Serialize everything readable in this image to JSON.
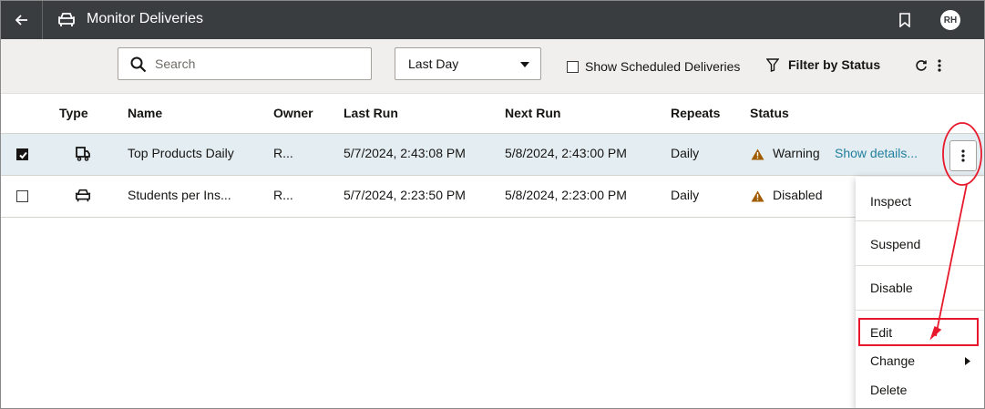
{
  "app": {
    "title": "Monitor Deliveries",
    "avatar_initials": "RH"
  },
  "toolbar": {
    "search_placeholder": "Search",
    "range_select": "Last Day",
    "show_scheduled_label": "Show Scheduled Deliveries",
    "show_scheduled_checked": false,
    "filter_label": "Filter by Status"
  },
  "table": {
    "headers": {
      "type": "Type",
      "name": "Name",
      "owner": "Owner",
      "last_run": "Last Run",
      "next_run": "Next Run",
      "repeats": "Repeats",
      "status": "Status"
    },
    "rows": [
      {
        "selected": true,
        "type_icon": "truck-icon",
        "name": "Top Products Daily",
        "owner": "R...",
        "last_run": "5/7/2024, 2:43:08 PM",
        "next_run": "5/8/2024, 2:43:00 PM",
        "repeats": "Daily",
        "status": "Warning",
        "status_link": "Show details..."
      },
      {
        "selected": false,
        "type_icon": "car-icon",
        "name": "Students per Ins...",
        "owner": "R...",
        "last_run": "5/7/2024, 2:23:50 PM",
        "next_run": "5/8/2024, 2:23:00 PM",
        "repeats": "Daily",
        "status": "Disabled",
        "status_link_fragment": "·"
      }
    ]
  },
  "context_menu": {
    "items": [
      "Inspect",
      "Suspend",
      "Disable",
      "Edit",
      "Change",
      "Delete"
    ],
    "highlighted": "Edit"
  },
  "colors": {
    "titlebar": "#3a3d40",
    "toolbar": "#f1efed",
    "selected_row": "#e4eef2",
    "link": "#227e9e",
    "warning": "#a15b00",
    "annotation": "#e8182c"
  }
}
